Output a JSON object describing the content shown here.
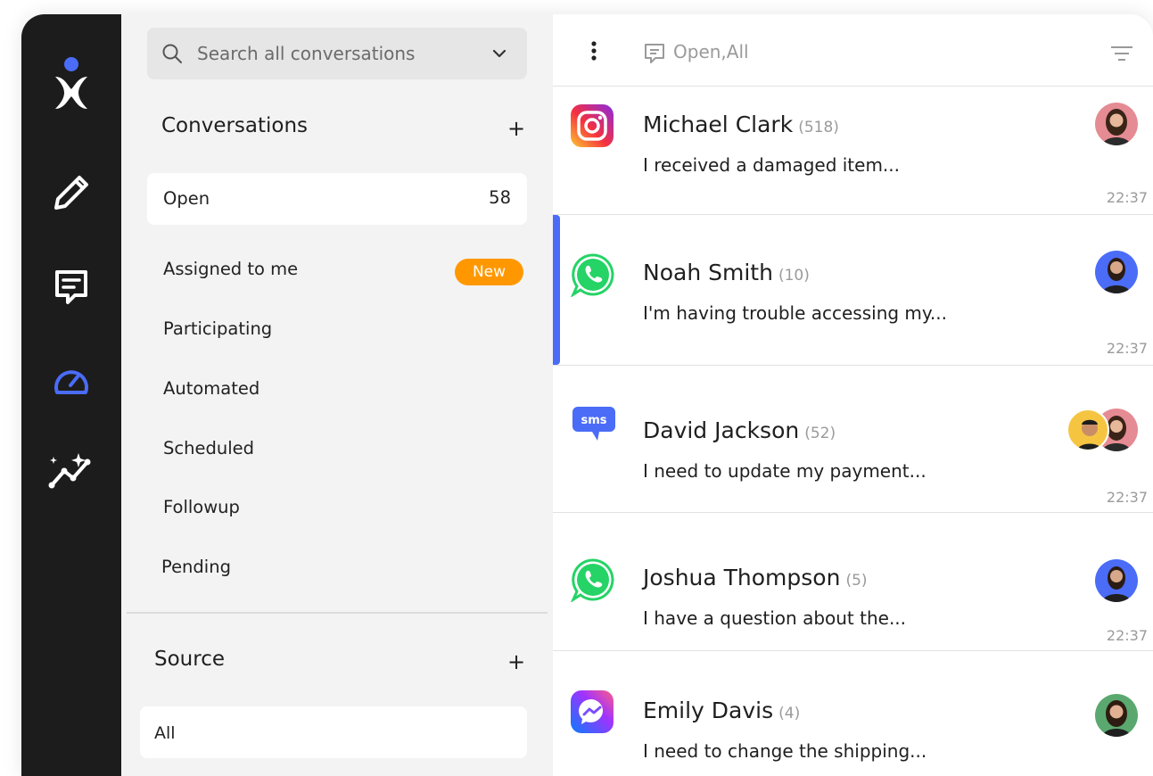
{
  "search": {
    "placeholder": "Search all conversations"
  },
  "conversations_section": {
    "title": "Conversations",
    "add": "+",
    "open": {
      "label": "Open",
      "count": "58"
    },
    "items": [
      {
        "label": "Assigned to me",
        "badge": "New"
      },
      {
        "label": "Participating"
      },
      {
        "label": "Automated"
      },
      {
        "label": "Scheduled"
      },
      {
        "label": "Followup"
      },
      {
        "label": "Pending"
      }
    ]
  },
  "source_section": {
    "title": "Source",
    "add": "+",
    "selected": "All"
  },
  "list_header": {
    "filter": "Open,All"
  },
  "conversations": [
    {
      "name": "Michael Clark",
      "count": "(518)",
      "message": "I received a damaged item...",
      "time": "22:37",
      "source": "instagram-icon"
    },
    {
      "name": "Noah Smith",
      "count": "(10)",
      "message": "I'm having trouble accessing my...",
      "time": "22:37",
      "source": "whatsapp-icon"
    },
    {
      "name": "David Jackson",
      "count": "(52)",
      "message": "I need to update my payment...",
      "time": "22:37",
      "source": "sms-icon"
    },
    {
      "name": "Joshua Thompson",
      "count": "(5)",
      "message": "I have a question about the...",
      "time": "22:37",
      "source": "whatsapp-icon"
    },
    {
      "name": "Emily Davis",
      "count": "(4)",
      "message": "I need to change the shipping...",
      "time": "",
      "source": "messenger-icon"
    }
  ],
  "colors": {
    "rail": "#1c1c1c",
    "accent_blue": "#4a6cf7",
    "badge_orange": "#ff9800",
    "sidebar_bg": "#f3f3f3"
  },
  "sms_icon_text": "sms"
}
